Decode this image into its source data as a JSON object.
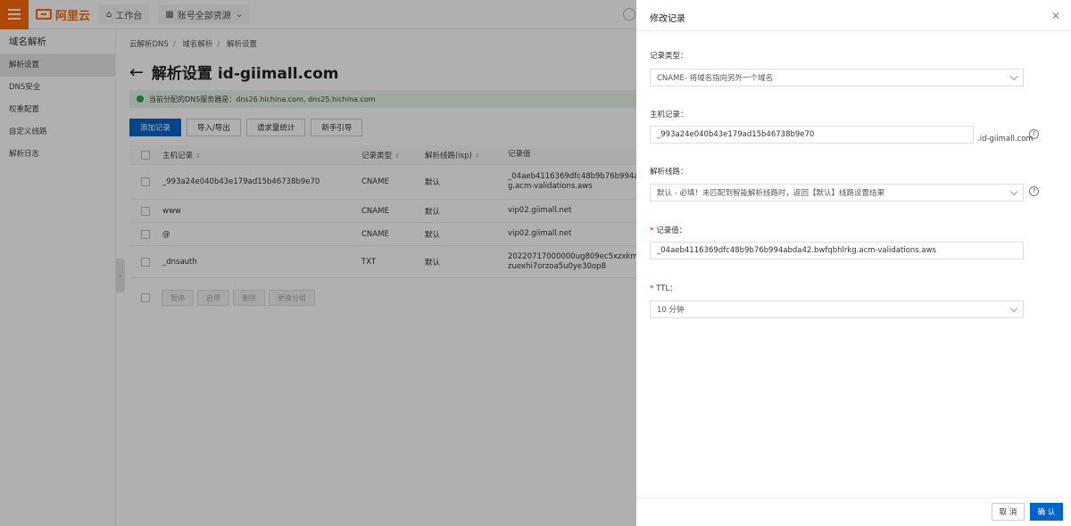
{
  "topbar": {
    "logo_text": "阿里云",
    "workbench": "工作台",
    "resources": "账号全部资源"
  },
  "sidebar": {
    "title": "域名解析",
    "items": [
      {
        "label": "解析设置"
      },
      {
        "label": "DNS安全"
      },
      {
        "label": "权重配置"
      },
      {
        "label": "自定义线路"
      },
      {
        "label": "解析日志"
      }
    ]
  },
  "main": {
    "breadcrumb": [
      "云解析DNS",
      "域名解析",
      "解析设置"
    ],
    "title": "解析设置 id-giimall.com",
    "notice_label": "当前分配的DNS服务器是：",
    "notice_value": "dns26.hichina.com, dns25.hichina.com",
    "toolbar": [
      "添加记录",
      "导入/导出",
      "请求量统计",
      "新手引导"
    ],
    "columns": [
      "主机记录",
      "记录类型",
      "解析线路(isp)",
      "记录值"
    ],
    "rows": [
      {
        "host": "_993a24e040b43e179ad15b46738b9e70",
        "type": "CNAME",
        "line": "默认",
        "value1": "_04aeb4116369dfc48b9b76b994abda",
        "value2": "g.acm-validations.aws"
      },
      {
        "host": "www",
        "type": "CNAME",
        "line": "默认",
        "value1": "vip02.giimall.net",
        "value2": ""
      },
      {
        "host": "@",
        "type": "CNAME",
        "line": "默认",
        "value1": "vip02.giimall.net",
        "value2": ""
      },
      {
        "host": "_dnsauth",
        "type": "TXT",
        "line": "默认",
        "value1": "20220717000000ug809ec5xzxkmmf",
        "value2": "zuexhi7orzoa5u0ye30op8"
      }
    ],
    "bulk_actions": [
      "暂停",
      "启用",
      "删除",
      "更换分组"
    ]
  },
  "drawer": {
    "title": "修改记录",
    "record_type_label": "记录类型：",
    "record_type_value": "CNAME- 将域名指向另外一个域名",
    "host_label": "主机记录：",
    "host_value": "_993a24e040b43e179ad15b46738b9e70",
    "host_suffix": ".id-giimall.com",
    "line_label": "解析线路：",
    "line_value": "默认 - 必填！未匹配到智能解析线路时，返回【默认】线路设置结果",
    "value_label": "记录值：",
    "value_value": "_04aeb4116369dfc48b9b76b994abda42.bwfqbhlrkg.acm-validations.aws",
    "ttl_label": "TTL：",
    "ttl_value": "10 分钟",
    "cancel": "取 消",
    "confirm": "确 认"
  }
}
